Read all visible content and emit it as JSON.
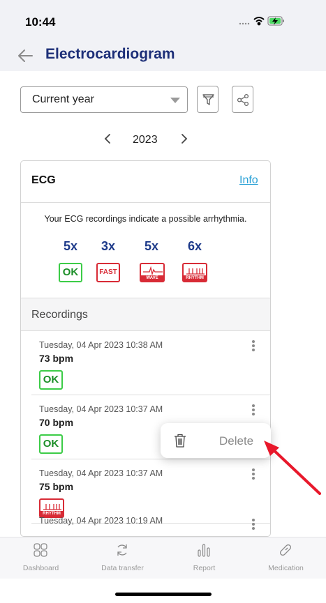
{
  "status": {
    "time": "10:44",
    "icons": [
      "signal-dots-icon",
      "wifi-icon",
      "battery-charging-icon"
    ]
  },
  "nav": {
    "title": "Electrocardiogram",
    "back_icon": "back-arrow-icon"
  },
  "filters": {
    "period_value": "Current year",
    "filter_icon": "filter-icon",
    "share_icon": "share-icon"
  },
  "year_nav": {
    "year": "2023",
    "prev_icon": "chevron-left-icon",
    "next_icon": "chevron-right-icon"
  },
  "ecg_card": {
    "title": "ECG",
    "info_link": "Info",
    "summary": "Your ECG recordings indicate a possible arrhythmia.",
    "stats": [
      {
        "count": "5x",
        "badge": "OK"
      },
      {
        "count": "3x",
        "badge": "FAST"
      },
      {
        "count": "5x",
        "badge": "WAVE"
      },
      {
        "count": "6x",
        "badge": "RHYTHM"
      }
    ],
    "recordings_header": "Recordings",
    "recordings": [
      {
        "date": "Tuesday, 04 Apr 2023 10:38 AM",
        "bpm": "73 bpm",
        "badge": "OK"
      },
      {
        "date": "Tuesday, 04 Apr 2023 10:37 AM",
        "bpm": "70 bpm",
        "badge": "OK"
      },
      {
        "date": "Tuesday, 04 Apr 2023 10:37 AM",
        "bpm": "75 bpm",
        "badge": "RHYTHM"
      },
      {
        "date": "Tuesday, 04 Apr 2023 10:19 AM",
        "bpm": "",
        "badge": ""
      }
    ]
  },
  "context_menu": {
    "action": "Delete",
    "icon": "trash-icon"
  },
  "tabs": [
    {
      "label": "Dashboard",
      "icon": "dashboard-icon"
    },
    {
      "label": "Data transfer",
      "icon": "sync-icon"
    },
    {
      "label": "Report",
      "icon": "report-icon"
    },
    {
      "label": "Medication",
      "icon": "pill-icon"
    }
  ],
  "colors": {
    "title": "#1d2f78",
    "count": "#1d3a8a",
    "ok_green": "#3ccc47",
    "alert_red": "#d82b36",
    "link": "#2aa1d6",
    "annotation_arrow": "#e8182b"
  }
}
